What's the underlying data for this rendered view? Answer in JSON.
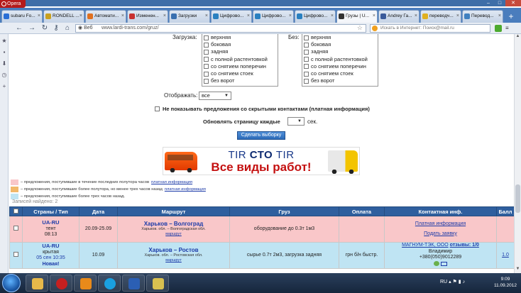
{
  "browser": {
    "app_name": "Opera",
    "tabs": [
      {
        "label": "subaru Fo...",
        "color": "#2a6fd6"
      },
      {
        "label": "RONDELL ...",
        "color": "#c8a020"
      },
      {
        "label": "Автомати...",
        "color": "#e07020"
      },
      {
        "label": "Изменен...",
        "color": "#c83030"
      },
      {
        "label": "Загрузки",
        "color": "#3a70b0"
      },
      {
        "label": "Цифрово...",
        "color": "#2a80c0"
      },
      {
        "label": "Цифрово...",
        "color": "#2a80c0"
      },
      {
        "label": "Цифрово...",
        "color": "#2a80c0"
      },
      {
        "label": "Грузы | U...",
        "color": "#333333"
      },
      {
        "label": "Andrey Га...",
        "color": "#3a5a9a"
      },
      {
        "label": "переводч...",
        "color": "#e0b020"
      },
      {
        "label": "Перевод...",
        "color": "#4080c0"
      }
    ],
    "web_label": "Веб",
    "url": "www.lardi-trans.com/gruz/",
    "search_placeholder": "Искать в Интернет: Поиск@mail.ru"
  },
  "filters": {
    "load_label": "Загрузка:",
    "without_label": "Без:",
    "load_options": [
      "верхняя",
      "боковая",
      "задняя",
      "с полной растентовкой",
      "со снятием поперечин",
      "со снятием стоек",
      "без ворот"
    ],
    "without_options": [
      "верхняя",
      "боковая",
      "задняя",
      "с полной растентовкой",
      "со снятием поперечин",
      "со снятием стоек",
      "без ворот"
    ],
    "display_label": "Отображать:",
    "display_value": "все",
    "hide_hidden_label": "Не показывать предложения со скрытыми контактами (платная информация)",
    "refresh_label": "Обновлять страницу каждые",
    "refresh_value": "",
    "refresh_unit": "сек.",
    "submit_label": "Сделать выборку"
  },
  "banner": {
    "line1_a": "TIR ",
    "line1_b": "СТО",
    "line1_c": " TIR",
    "line2": "Все виды работ!"
  },
  "legend": [
    {
      "color": "#f9c7c9",
      "text": "– предложения, поступившие в течение последних полутора часов",
      "link": "платная информация"
    },
    {
      "color": "#f2b86a",
      "text": "– предложения, поступившие более полутора, но менее трех часов назад",
      "link": "платная информация"
    },
    {
      "color": "#bfe4f3",
      "text": "– предложения, поступившие более трех часов назад.",
      "link": ""
    }
  ],
  "found_text": "Записей найдено: 2",
  "table": {
    "headers": [
      "",
      "Страны / Тип",
      "Дата",
      "Маршрут",
      "Груз",
      "Оплата",
      "Контактная инф.",
      "Балл"
    ],
    "rows": [
      {
        "country": "UA-RU",
        "type": "тент",
        "time": "08:13",
        "new": "",
        "date": "20.09-25.09",
        "route": "Харьков – Волгоград",
        "route_detail": "Харьков. обл. – Волгоградская обл.",
        "map_link": "маршрут",
        "cargo": "оборудование до 0.3т 1м3",
        "payment": "",
        "contact_1": "Платная информация",
        "contact_2": "Подать заявку",
        "score": ""
      },
      {
        "country": "UA-RU",
        "type": "крытая",
        "time": "05 сен 10:35",
        "new": "Новая!",
        "date": "10.09",
        "route": "Харьков – Ростов",
        "route_detail": "Харьков. обл. – Ростовская обл.",
        "map_link": "маршрут",
        "cargo": "сырье 0.7т 2м3, загрузка задняя",
        "payment": "грн б/н быстр.",
        "contact_1": "МАГНУМ-ТЭК, ООО",
        "contact_reviews": "отзывы: 1/0",
        "contact_2": "Владимир",
        "contact_3": "+380(050)9012289",
        "score": "1.0"
      }
    ]
  },
  "taskbar": {
    "lang": "RU",
    "time": "9:09",
    "date": "11.09.2012"
  }
}
